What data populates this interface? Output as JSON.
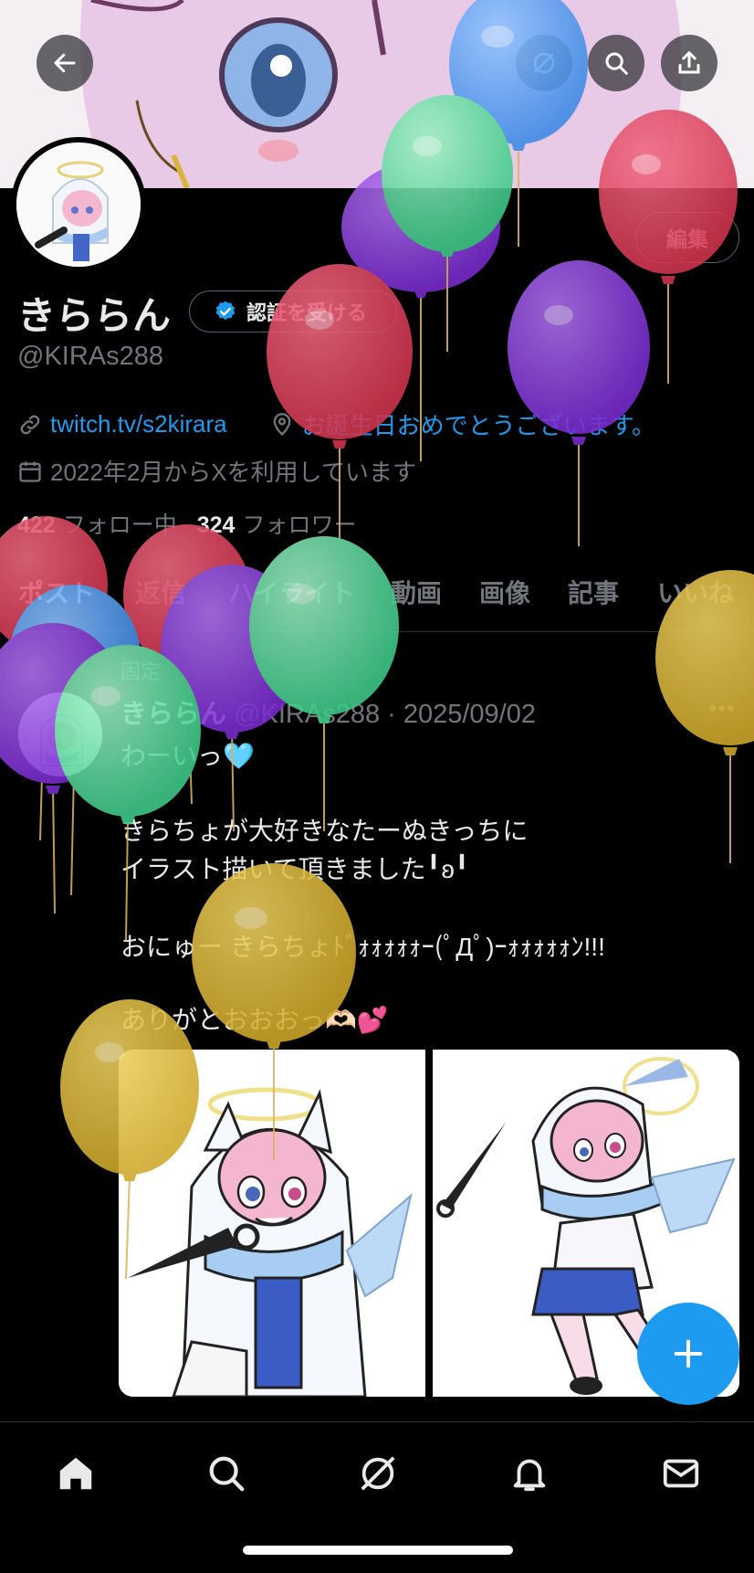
{
  "profile": {
    "name": "きららん",
    "handle": "@KIRAs288",
    "verify_label": "認証を受ける",
    "edit_label": "編集",
    "link_text": "twitch.tv/s2kirara",
    "location_text": "お誕生日おめでとうございます。",
    "joined_text": "2022年2月からXを利用しています",
    "following_count": "422",
    "following_label": "フォロー中",
    "followers_count": "324",
    "followers_label": "フォロワー"
  },
  "tabs": [
    "ポスト",
    "返信",
    "ハイライト",
    "動画",
    "画像",
    "記事",
    "いいね"
  ],
  "post": {
    "pinned_label": "固定",
    "author": "きららん",
    "meta": "@KIRAs288 · 2025/09/02",
    "lines": [
      "わーいっ🩵",
      "",
      "きらちょが大好きなたーぬきっちに",
      "イラスト描いて頂きました╹ʚ╹",
      "",
      "おにゅー きらちょﾄﾞｫｫｫｫｫｰ(ﾟДﾟ)ｰｫｫｫｫｫﾝ!!!",
      "",
      "ありがとおおおっ🫶🏻💕"
    ]
  },
  "icons": {
    "back": "arrow-left-icon",
    "grok": "grok-icon",
    "search": "search-icon",
    "share": "share-icon",
    "verified": "verified-badge-icon",
    "link": "link-icon",
    "location": "location-pin-icon",
    "calendar": "calendar-icon",
    "compose": "plus-icon",
    "home": "home-icon",
    "explore": "search-icon",
    "notifications": "bell-icon",
    "messages": "mail-icon"
  },
  "colors": {
    "accent": "#1d9bf0",
    "background": "#000000",
    "muted": "#71767b",
    "text": "#e7e9ea"
  }
}
